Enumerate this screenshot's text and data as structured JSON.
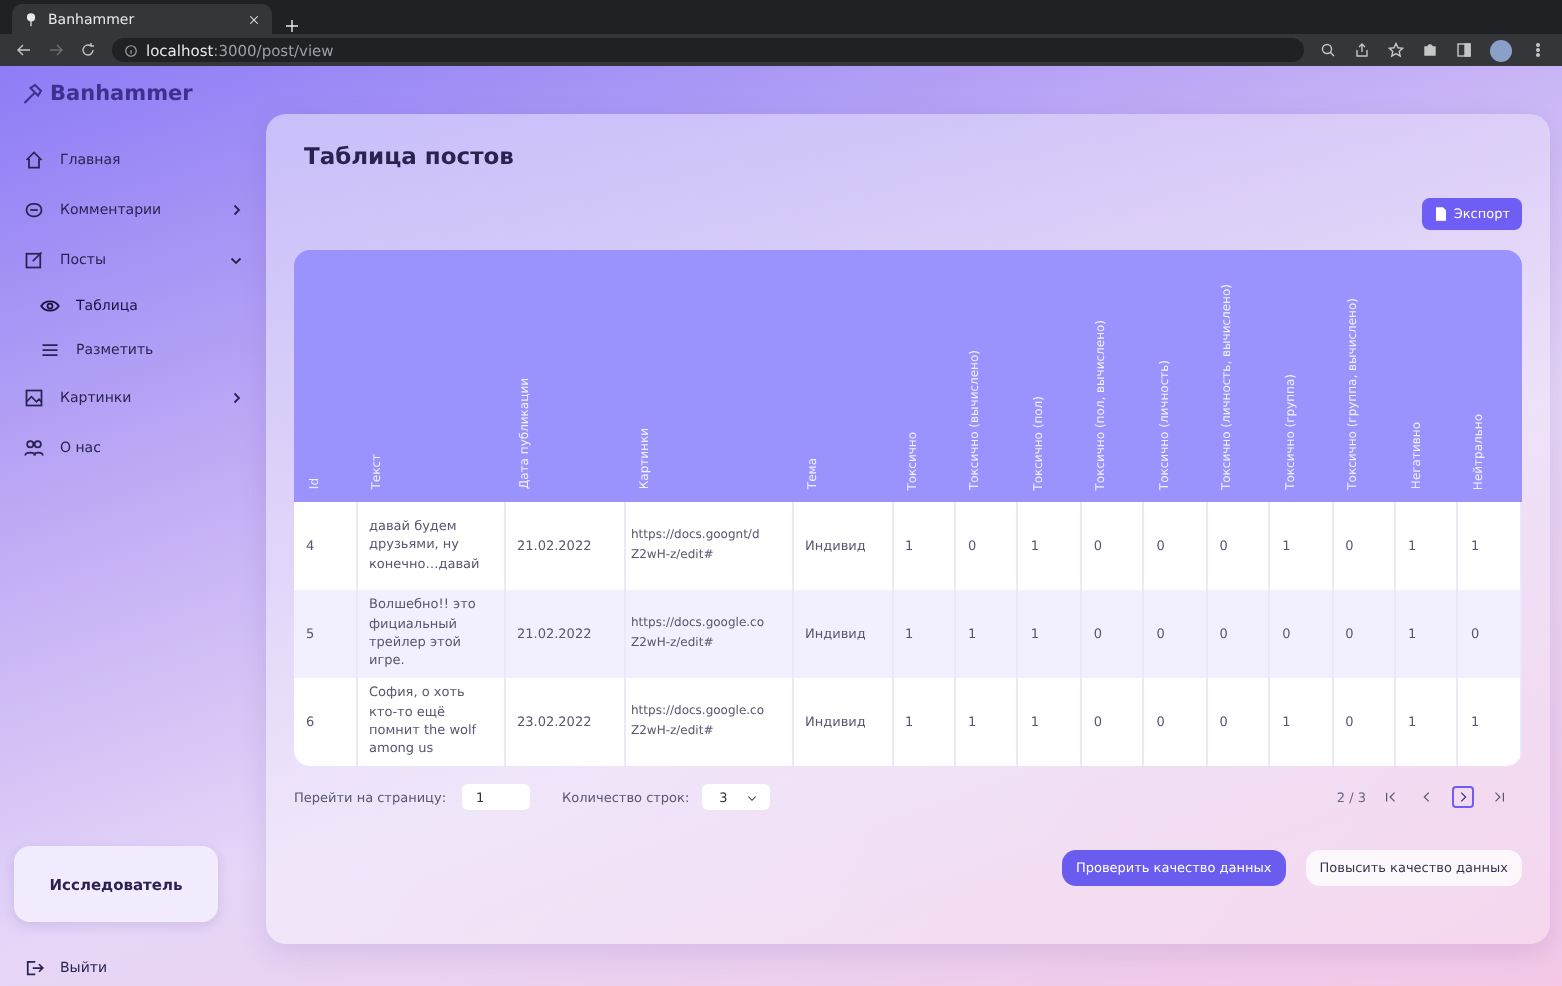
{
  "browser": {
    "tab_title": "Banhammer",
    "url_host": "localhost",
    "url_path": ":3000/post/view"
  },
  "sidebar": {
    "logo": "Banhammer",
    "items": [
      {
        "kind": "home",
        "label": "Главная"
      },
      {
        "kind": "comments",
        "label": "Комментарии",
        "expanded": false
      },
      {
        "kind": "posts",
        "label": "Посты",
        "expanded": true,
        "children": [
          {
            "kind": "eye",
            "label": "Таблица",
            "selected": true
          },
          {
            "kind": "list",
            "label": "Разметить",
            "selected": false
          }
        ]
      },
      {
        "kind": "images",
        "label": "Картинки",
        "expanded": false
      },
      {
        "kind": "about",
        "label": "О нас"
      }
    ],
    "role": "Исследователь",
    "logout": "Выйти"
  },
  "main": {
    "title": "Таблица постов",
    "export_button": "Экспорт",
    "table": {
      "columns": [
        "Id",
        "Текст",
        "Дата публикации",
        "Картинки",
        "Тема",
        "Токсично",
        "Токсично (вычислено)",
        "Токсично (пол)",
        "Токсично (пол, вычислено)",
        "Токсично (личность)",
        "Токсично (личность, вычислено)",
        "Токсично (группа)",
        "Токсично (группа, вычислено)",
        "Негативно",
        "Нейтрально"
      ],
      "rows": [
        {
          "id": "4",
          "text": "давай будем друзьями, ну конечно…давай",
          "date": "21.02.2022",
          "images": "https://docs.goognt/d\nZ2wH-z/edit#",
          "topic": "Индивид",
          "flags": [
            "1",
            "0",
            "1",
            "0",
            "0",
            "0",
            "1",
            "0",
            "1",
            "1"
          ]
        },
        {
          "id": "5",
          "text": "Волшебно!! это фициальный трейлер этой игре.",
          "date": "21.02.2022",
          "images": "https://docs.google.co\nZ2wH-z/edit#",
          "topic": "Индивид",
          "flags": [
            "1",
            "1",
            "1",
            "0",
            "0",
            "0",
            "0",
            "0",
            "1",
            "0"
          ]
        },
        {
          "id": "6",
          "text": "София, о хоть кто-то ещё помнит the wolf among us",
          "date": "23.02.2022",
          "images": "https://docs.google.co\nZ2wH-z/edit#",
          "topic": "Индивид",
          "flags": [
            "1",
            "1",
            "1",
            "0",
            "0",
            "0",
            "1",
            "0",
            "1",
            "1"
          ]
        }
      ]
    },
    "pagination": {
      "goto_label": "Перейти на страницу:",
      "goto_value": "1",
      "rows_label": "Количество строк:",
      "rows_value": "3",
      "page_info": "2 / 3"
    },
    "actions": [
      "Проверить качество данных",
      "Повысить качество данных"
    ]
  }
}
